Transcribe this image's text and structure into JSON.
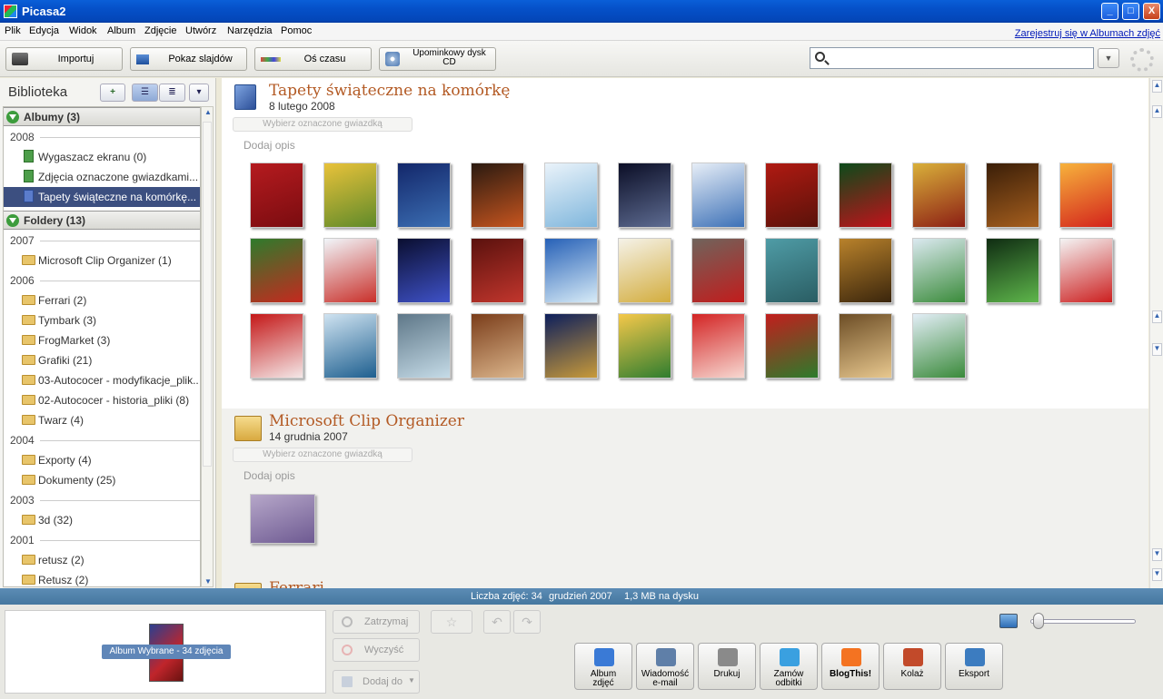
{
  "window": {
    "title": "Picasa2",
    "minimize": "_",
    "maximize": "□",
    "close": "X"
  },
  "menu": {
    "items": [
      "Plik",
      "Edycja",
      "Widok",
      "Album",
      "Zdjęcie",
      "Utwórz",
      "Narzędzia",
      "Pomoc"
    ],
    "register_link": "Zarejestruj się w Albumach zdjęć"
  },
  "toolbar": {
    "import": "Importuj",
    "slideshow": "Pokaz slajdów",
    "timeline": "Oś czasu",
    "gift_cd": "Upominkowy dysk CD",
    "search_value": "",
    "search_dropdown": "▼"
  },
  "library": {
    "title": "Biblioteka",
    "add_button": "+",
    "albums_header": "Albumy (3)",
    "folders_header": "Foldery (13)",
    "entries": [
      {
        "kind": "year",
        "text": "2008"
      },
      {
        "kind": "album",
        "text": "Wygaszacz ekranu (0)",
        "selected": false
      },
      {
        "kind": "album",
        "text": "Zdjęcia oznaczone gwiazdkami...",
        "selected": false
      },
      {
        "kind": "album",
        "text": "Tapety świąteczne na komórkę...",
        "selected": true
      },
      {
        "kind": "year",
        "text": "2007"
      },
      {
        "kind": "folder",
        "text": "Microsoft Clip Organizer (1)"
      },
      {
        "kind": "year",
        "text": "2006"
      },
      {
        "kind": "folder",
        "text": "Ferrari (2)"
      },
      {
        "kind": "folder",
        "text": "Tymbark (3)"
      },
      {
        "kind": "folder",
        "text": "FrogMarket (3)"
      },
      {
        "kind": "folder",
        "text": "Grafiki (21)"
      },
      {
        "kind": "folder",
        "text": "03-Autococer - modyfikacje_plik..."
      },
      {
        "kind": "folder",
        "text": "02-Autococer - historia_pliki (8)"
      },
      {
        "kind": "folder",
        "text": "Twarz (4)"
      },
      {
        "kind": "year",
        "text": "2004"
      },
      {
        "kind": "folder",
        "text": "Exporty (4)"
      },
      {
        "kind": "folder",
        "text": "Dokumenty (25)"
      },
      {
        "kind": "year",
        "text": "2003"
      },
      {
        "kind": "folder",
        "text": "3d (32)"
      },
      {
        "kind": "year",
        "text": "2001"
      },
      {
        "kind": "folder",
        "text": "retusz (2)"
      },
      {
        "kind": "folder",
        "text": "Retusz (2)"
      }
    ]
  },
  "main": {
    "sections": [
      {
        "title": "Tapety świąteczne na komórkę",
        "date": "8 lutego 2008",
        "star_button": "Wybierz oznaczone gwiazdką",
        "add_description": "Dodaj opis",
        "thumbnails": [
          [
            "#b51b1f",
            "#7a0c10"
          ],
          [
            "#e9c23a",
            "#5f8a2a"
          ],
          [
            "#13276a",
            "#3c6fb4"
          ],
          [
            "#2a1a10",
            "#c7551f"
          ],
          [
            "#eaf3fa",
            "#7fb6dc"
          ],
          [
            "#0b0e26",
            "#5e6c92"
          ],
          [
            "#e7eef7",
            "#3d71b7"
          ],
          [
            "#b01a12",
            "#5a120a"
          ],
          [
            "#0b4a1a",
            "#c3121b"
          ],
          [
            "#d9b03a",
            "#8c1e14"
          ],
          [
            "#3a1e08",
            "#a65f1e"
          ],
          [
            "#f7b23c",
            "#d3231c"
          ],
          [
            "#2e7b2c",
            "#c5291f"
          ],
          [
            "#f1f6fa",
            "#c9302a"
          ],
          [
            "#0a0e30",
            "#3f52c8"
          ],
          [
            "#5a110d",
            "#c2362d"
          ],
          [
            "#2761b7",
            "#d7ebf7"
          ],
          [
            "#f5f2e8",
            "#d3ad3e"
          ],
          [
            "#6f645c",
            "#c21c1c"
          ],
          [
            "#4f9ca6",
            "#2a5d63"
          ],
          [
            "#b9822b",
            "#3a250c"
          ],
          [
            "#dbe9f0",
            "#3a8b3a"
          ],
          [
            "#0f2c12",
            "#5eb64b"
          ],
          [
            "#f4f4f4",
            "#cc1f1f"
          ],
          [
            "#c41818",
            "#f4e7e7"
          ],
          [
            "#cfe3f1",
            "#1e5f8f"
          ],
          [
            "#5e7788",
            "#c5dbe7"
          ],
          [
            "#7a3d1a",
            "#dcb68c"
          ],
          [
            "#0d1f5c",
            "#c89a3a"
          ],
          [
            "#f5c84a",
            "#2f7d2f"
          ],
          [
            "#d32424",
            "#f7d8d1"
          ],
          [
            "#c21d1d",
            "#2c7c2c"
          ],
          [
            "#6c4d25",
            "#e8c88f"
          ],
          [
            "#e3eef7",
            "#3a8a3a"
          ]
        ]
      },
      {
        "title": "Microsoft Clip Organizer",
        "date": "14 grudnia 2007",
        "star_button": "Wybierz oznaczone gwiazdką",
        "add_description": "Dodaj opis",
        "thumbnails": [
          [
            "#b6a7c9",
            "#6e5a92"
          ]
        ]
      },
      {
        "title": "Ferrari",
        "date": "",
        "star_button": "",
        "add_description": "",
        "thumbnails": []
      }
    ]
  },
  "status": {
    "count": "Liczba zdjęć: 34",
    "date": "grudzień 2007",
    "size": "1,3 MB na dysku"
  },
  "tray": {
    "caption": "Album Wybrane - 34 zdjęcia",
    "hold": "Zatrzymaj",
    "clear": "Wyczyść",
    "add_to": "Dodaj do"
  },
  "edit": {
    "star": "☆",
    "rotate_left": "↶",
    "rotate_right": "↷"
  },
  "actions": [
    {
      "name": "web-album",
      "label": "Album\nzdjęć",
      "color": "#3a7ad6"
    },
    {
      "name": "email",
      "label": "Wiadomość\ne-mail",
      "color": "#5f7fa8"
    },
    {
      "name": "print",
      "label": "Drukuj",
      "color": "#8a8a8a"
    },
    {
      "name": "order-prints",
      "label": "Zamów\nodbitki",
      "color": "#3aa0e0"
    },
    {
      "name": "blogthis",
      "label": "BlogThis!",
      "color": "#f47321"
    },
    {
      "name": "collage",
      "label": "Kolaż",
      "color": "#c24a2a"
    },
    {
      "name": "export",
      "label": "Eksport",
      "color": "#3c7cc0"
    }
  ],
  "zoom": {
    "level": 0.05
  }
}
